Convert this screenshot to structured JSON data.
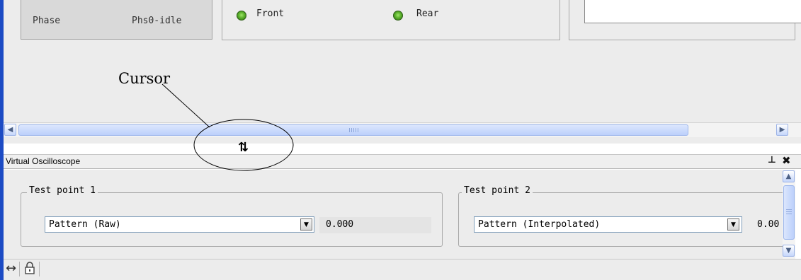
{
  "status_panel": {
    "phase_label": "Phase",
    "phase_value": "Phs0-idle",
    "indicators": [
      {
        "label": "Front",
        "state": "on",
        "color": "#5cb22c"
      },
      {
        "label": "Rear",
        "state": "on",
        "color": "#5cb22c"
      }
    ]
  },
  "annotation": {
    "label": "Cursor"
  },
  "splitter": {
    "cursor_icon": "resize-vertical-icon"
  },
  "oscilloscope": {
    "title": "Virtual Oscilloscope",
    "title_icons": [
      "pin-icon",
      "close-icon"
    ],
    "test_points": [
      {
        "legend": "Test point 1",
        "selected": "Pattern (Raw)",
        "value": "0.000"
      },
      {
        "legend": "Test point 2",
        "selected": "Pattern (Interpolated)",
        "value": "0.00"
      }
    ]
  },
  "toolbar": {
    "icons": [
      "fit-width-icon",
      "lock-icon"
    ]
  },
  "colors": {
    "window_frame": "#1c4bc4",
    "panel_bg": "#ececec",
    "scroll_accent": "#bcd0fb"
  }
}
